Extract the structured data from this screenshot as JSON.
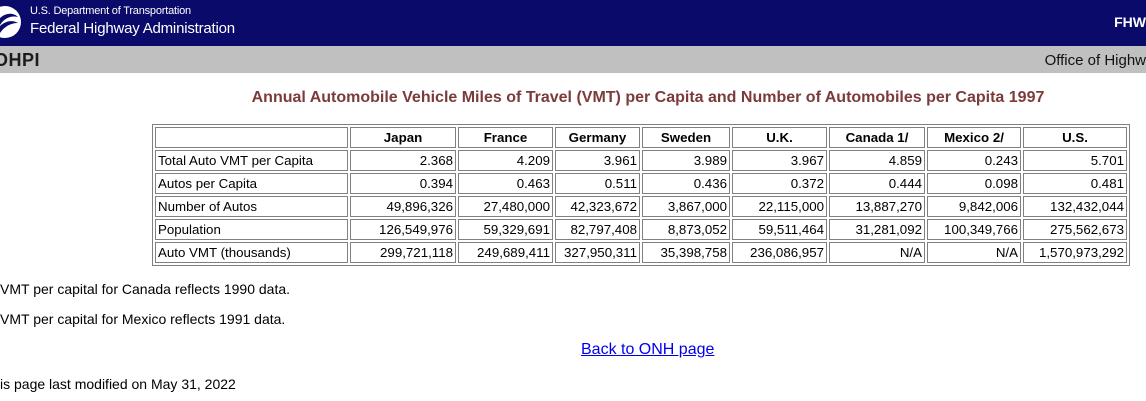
{
  "header": {
    "dept": "U.S. Department of Transportation",
    "agency": "Federal Highway Administration",
    "right_text": "FHW"
  },
  "subheader": {
    "left": "OHPI",
    "right": "Office of Highw"
  },
  "title": "Annual Automobile Vehicle Miles of Travel (VMT) per Capita and Number of Automobiles per Capita 1997",
  "table": {
    "columns": [
      "",
      "Japan",
      "France",
      "Germany",
      "Sweden",
      "U.K.",
      "Canada 1/",
      "Mexico 2/",
      "U.S."
    ],
    "rows": [
      [
        "Total Auto VMT per Capita",
        "2.368",
        "4.209",
        "3.961",
        "3.989",
        "3.967",
        "4.859",
        "0.243",
        "5.701"
      ],
      [
        "Autos per Capita",
        "0.394",
        "0.463",
        "0.511",
        "0.436",
        "0.372",
        "0.444",
        "0.098",
        "0.481"
      ],
      [
        "Number of Autos",
        "49,896,326",
        "27,480,000",
        "42,323,672",
        "3,867,000",
        "22,115,000",
        "13,887,270",
        "9,842,006",
        "132,432,044"
      ],
      [
        "Population",
        "126,549,976",
        "59,329,691",
        "82,797,408",
        "8,873,052",
        "59,511,464",
        "31,281,092",
        "100,349,766",
        "275,562,673"
      ],
      [
        "Auto VMT (thousands)",
        "299,721,118",
        "249,689,411",
        "327,950,311",
        "35,398,758",
        "236,086,957",
        "N/A",
        "N/A",
        "1,570,973,292"
      ]
    ]
  },
  "notes": {
    "canada": "VMT per capital for Canada reflects 1990 data.",
    "mexico": "VMT per capital for Mexico reflects 1991 data."
  },
  "back_link": "Back to ONH page",
  "footer": "is page last modified on May 31, 2022"
}
